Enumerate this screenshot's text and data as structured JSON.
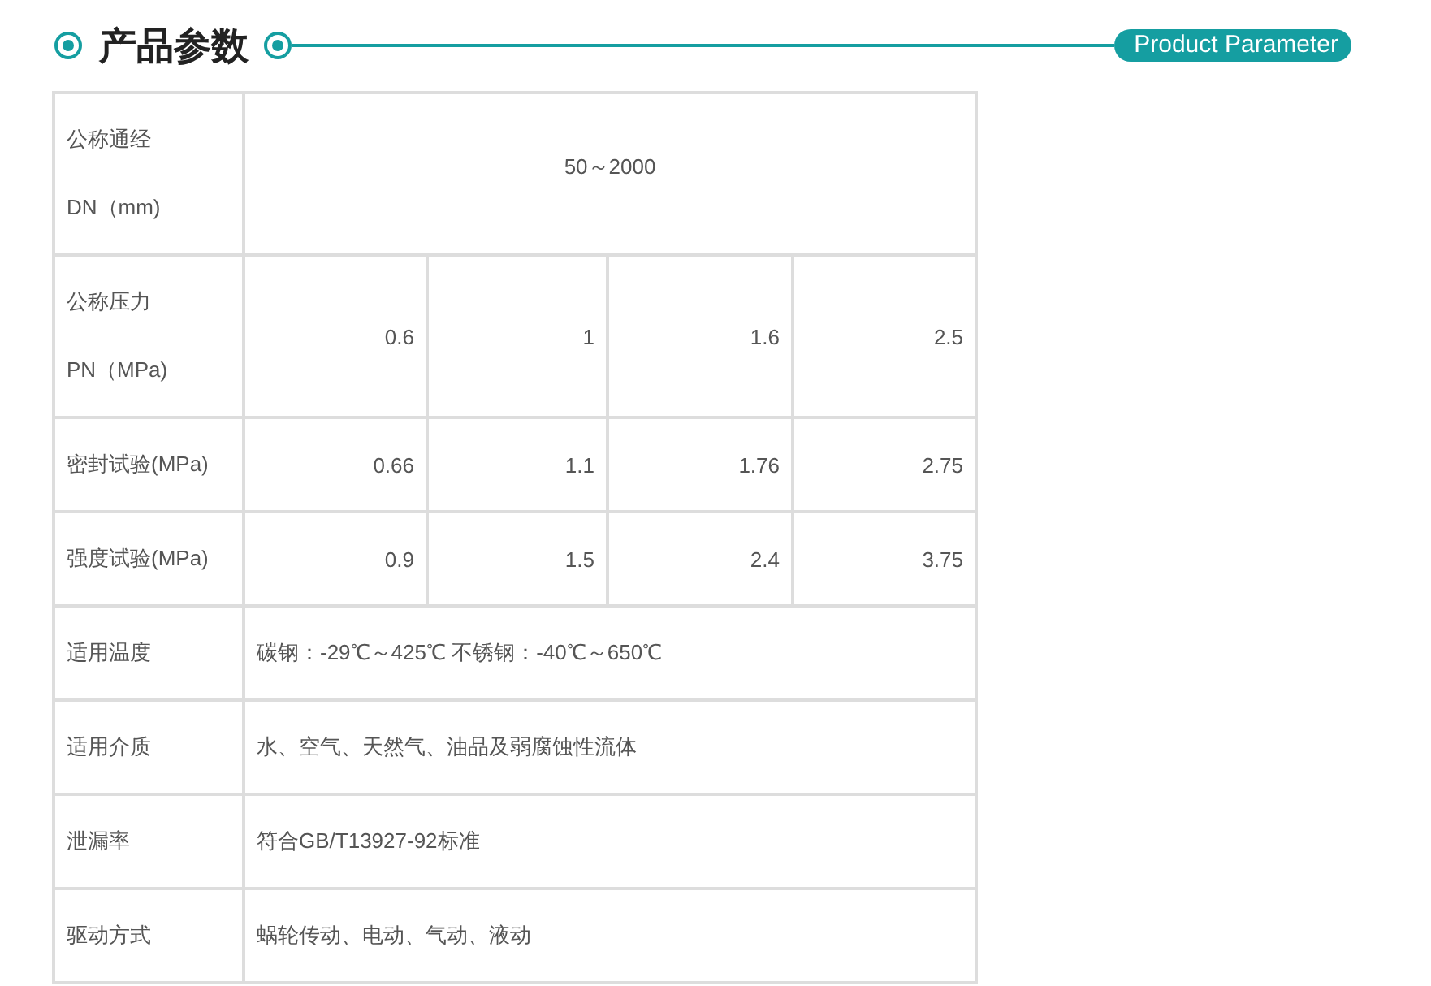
{
  "header": {
    "title": "产品参数",
    "badge": "Product Parameter"
  },
  "table": {
    "rows": [
      {
        "kind": "span",
        "label": "公称通经\nDN（mm)",
        "values": [
          "50～2000"
        ]
      },
      {
        "kind": "numbers",
        "label": "公称压力\nPN（MPa)",
        "values": [
          "0.6",
          "1",
          "1.6",
          "2.5"
        ]
      },
      {
        "kind": "numbers",
        "label": "密封试验(MPa)",
        "values": [
          "0.66",
          "1.1",
          "1.76",
          "2.75"
        ]
      },
      {
        "kind": "numbers",
        "label": "强度试验(MPa)",
        "values": [
          "0.9",
          "1.5",
          "2.4",
          "3.75"
        ]
      },
      {
        "kind": "text",
        "label": "适用温度",
        "values": [
          "碳钢：-29℃～425℃ 不锈钢：-40℃～650℃"
        ]
      },
      {
        "kind": "text",
        "label": "适用介质",
        "values": [
          "水、空气、天然气、油品及弱腐蚀性流体"
        ]
      },
      {
        "kind": "text",
        "label": "泄漏率",
        "values": [
          "符合GB/T13927-92标准"
        ]
      },
      {
        "kind": "text",
        "label": "驱动方式",
        "values": [
          "蜗轮传动、电动、气动、液动"
        ]
      }
    ]
  }
}
